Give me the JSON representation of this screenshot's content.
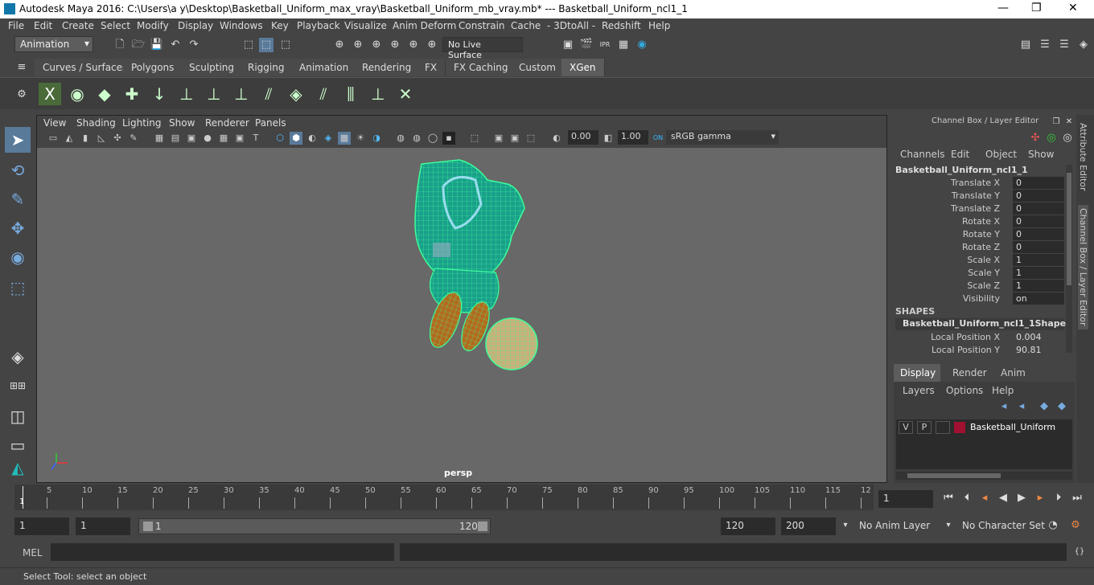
{
  "window": {
    "title": "Autodesk Maya 2016: C:\\Users\\a y\\Desktop\\Basketball_Uniform_max_vray\\Basketball_Uniform_mb_vray.mb*   ---   Basketball_Uniform_ncl1_1",
    "minimize": "—",
    "maximize": "❐",
    "close": "✕"
  },
  "menu": [
    "File",
    "Edit",
    "Create",
    "Select",
    "Modify",
    "Display",
    "Windows",
    "Key",
    "Playback",
    "Visualize",
    "Anim Deform",
    "Constrain",
    "Cache",
    "- 3DtoAll -",
    "Redshift",
    "Help"
  ],
  "status": {
    "mode_dropdown": "Animation",
    "live_surface": "No Live Surface"
  },
  "shelf_tabs": [
    "Curves / Surfaces",
    "Polygons",
    "Sculpting",
    "Rigging",
    "Animation",
    "Rendering",
    "FX",
    "FX Caching",
    "Custom",
    "XGen"
  ],
  "active_shelf_tab": "XGen",
  "viewport": {
    "menu": [
      "View",
      "Shading",
      "Lighting",
      "Show",
      "Renderer",
      "Panels"
    ],
    "exposure": "0.00",
    "gamma": "1.00",
    "colorspace": "sRGB gamma",
    "camera_label": "persp"
  },
  "channel_box": {
    "header": "Channel Box / Layer Editor",
    "menu": [
      "Channels",
      "Edit",
      "Object",
      "Show"
    ],
    "object_name": "Basketball_Uniform_ncl1_1",
    "attributes": [
      {
        "label": "Translate X",
        "value": "0"
      },
      {
        "label": "Translate Y",
        "value": "0"
      },
      {
        "label": "Translate Z",
        "value": "0"
      },
      {
        "label": "Rotate X",
        "value": "0"
      },
      {
        "label": "Rotate Y",
        "value": "0"
      },
      {
        "label": "Rotate Z",
        "value": "0"
      },
      {
        "label": "Scale X",
        "value": "1"
      },
      {
        "label": "Scale Y",
        "value": "1"
      },
      {
        "label": "Scale Z",
        "value": "1"
      },
      {
        "label": "Visibility",
        "value": "on"
      }
    ],
    "shapes_header": "SHAPES",
    "shape_name": "Basketball_Uniform_ncl1_1Shape",
    "shape_attributes": [
      {
        "label": "Local Position X",
        "value": "0.004"
      },
      {
        "label": "Local Position Y",
        "value": "90.81"
      }
    ]
  },
  "layer_editor": {
    "tabs": [
      "Display",
      "Render",
      "Anim"
    ],
    "active_tab": "Display",
    "menu": [
      "Layers",
      "Options",
      "Help"
    ],
    "layers": [
      {
        "v": "V",
        "p": "P",
        "name": "Basketball_Uniform",
        "color": "#a01030"
      }
    ]
  },
  "side_tabs": [
    "Attribute Editor",
    "Channel Box / Layer Editor"
  ],
  "timeline": {
    "ticks": [
      "1",
      "5",
      "10",
      "15",
      "20",
      "25",
      "30",
      "35",
      "40",
      "45",
      "50",
      "55",
      "60",
      "65",
      "70",
      "75",
      "80",
      "85",
      "90",
      "95",
      "100",
      "105",
      "110",
      "115",
      "12"
    ],
    "current_frame": "1"
  },
  "range": {
    "start": "1",
    "playback_start": "1",
    "slider_start": "1",
    "slider_end": "120",
    "playback_end": "120",
    "end": "200",
    "anim_layer": "No Anim Layer",
    "character_set": "No Character Set"
  },
  "mel": {
    "label": "MEL"
  },
  "help_line": "Select Tool: select an object",
  "colors": {
    "accent": "#2e8bd0",
    "active_tab": "#5c5c5c",
    "wire": "#3cff9a",
    "mesh": "#1aa08a"
  }
}
